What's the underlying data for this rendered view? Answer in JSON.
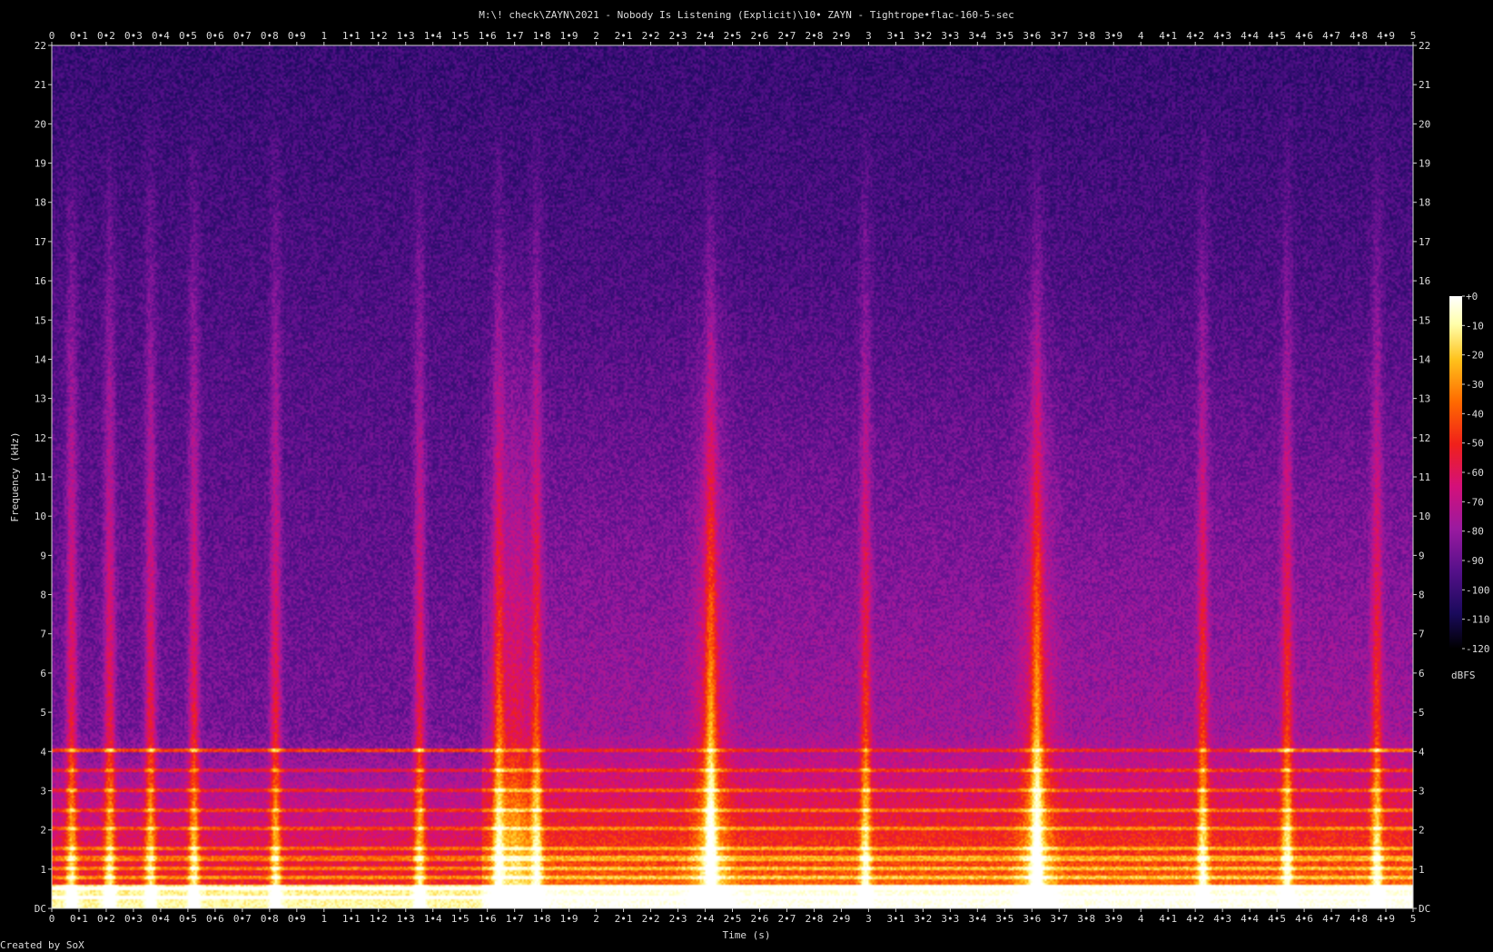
{
  "window": {
    "title": "M:\\! check\\ZAYN\\2021 - Nobody Is Listening (Explicit)\\10• ZAYN - Tightrope•flac-160-5-sec",
    "credit": "Created by SoX"
  },
  "chart_data": {
    "type": "heatmap",
    "title": "M:\\! check\\ZAYN\\2021 - Nobody Is Listening (Explicit)\\10• ZAYN - Tightrope•flac-160-5-sec",
    "xlabel": "Time (s)",
    "ylabel": "Frequency (kHz)",
    "xlim": [
      0,
      5
    ],
    "ylim": [
      0,
      22
    ],
    "x_ticks": [
      "0",
      "0•1",
      "0•2",
      "0•3",
      "0•4",
      "0•5",
      "0•6",
      "0•7",
      "0•8",
      "0•9",
      "1",
      "1•1",
      "1•2",
      "1•3",
      "1•4",
      "1•5",
      "1•6",
      "1•7",
      "1•8",
      "1•9",
      "2",
      "2•1",
      "2•2",
      "2•3",
      "2•4",
      "2•5",
      "2•6",
      "2•7",
      "2•8",
      "2•9",
      "3",
      "3•1",
      "3•2",
      "3•3",
      "3•4",
      "3•5",
      "3•6",
      "3•7",
      "3•8",
      "3•9",
      "4",
      "4•1",
      "4•2",
      "4•3",
      "4•4",
      "4•5",
      "4•6",
      "4•7",
      "4•8",
      "4•9",
      "5"
    ],
    "y_ticks": [
      "DC",
      "1",
      "2",
      "3",
      "4",
      "5",
      "6",
      "7",
      "8",
      "9",
      "10",
      "11",
      "12",
      "13",
      "14",
      "15",
      "16",
      "17",
      "18",
      "19",
      "20",
      "21",
      "22"
    ],
    "colorbar": {
      "label": "dBFS",
      "ticks": [
        "+0",
        "-10",
        "-20",
        "-30",
        "-40",
        "-50",
        "-60",
        "-70",
        "-80",
        "-90",
        "-100",
        "-110",
        "-120"
      ],
      "range": [
        -120,
        0
      ]
    },
    "transients_s": [
      0.07,
      0.21,
      0.36,
      0.52,
      0.82,
      1.35,
      1.64,
      1.78,
      2.42,
      2.99,
      3.62,
      4.23,
      4.54,
      4.87
    ],
    "harmonic_lines_khz": [
      0.25,
      0.5,
      0.75,
      1.0,
      1.25,
      1.5,
      2.0,
      2.5,
      3.0,
      3.5,
      4.0
    ],
    "colormap_hex": [
      "#000000",
      "#1a0a5c",
      "#55108a",
      "#9a1aa0",
      "#d4107a",
      "#f0201a",
      "#ff6a00",
      "#ffc21c",
      "#ffffaa",
      "#ffffff"
    ]
  }
}
